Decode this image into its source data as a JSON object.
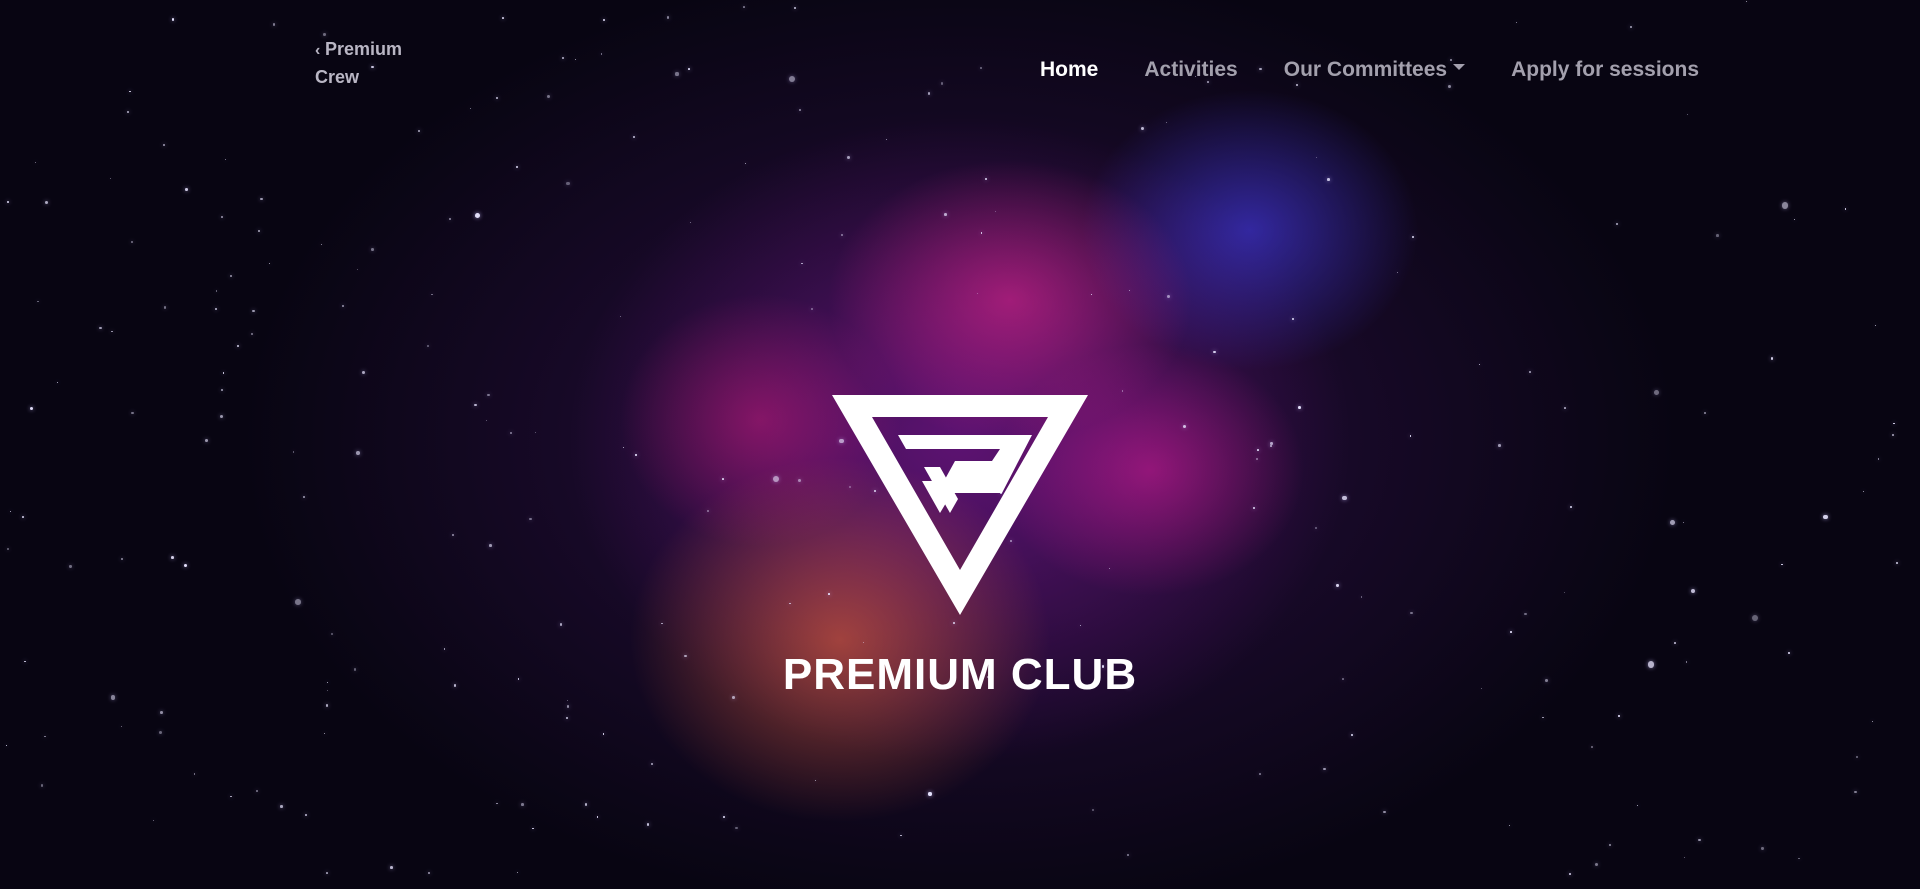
{
  "brand": {
    "icon": "chevron-left-icon",
    "line1": "Premium",
    "line2": "Crew"
  },
  "nav": {
    "items": [
      {
        "label": "Home",
        "active": true
      },
      {
        "label": "Activities",
        "active": false
      },
      {
        "label": "Our Committees",
        "active": false,
        "dropdown": true
      },
      {
        "label": "Apply for sessions",
        "active": false
      }
    ]
  },
  "hero": {
    "logo_icon": "premium-club-triangle-logo",
    "title": "PREMIUM CLUB"
  },
  "colors": {
    "nav_active": "#ffffff",
    "nav_inactive": "#a3a0ad",
    "background": "#06040d",
    "nebula_pink": "#e0259a",
    "nebula_blue": "#4a3cf0",
    "nebula_orange": "#ff6e3c"
  }
}
